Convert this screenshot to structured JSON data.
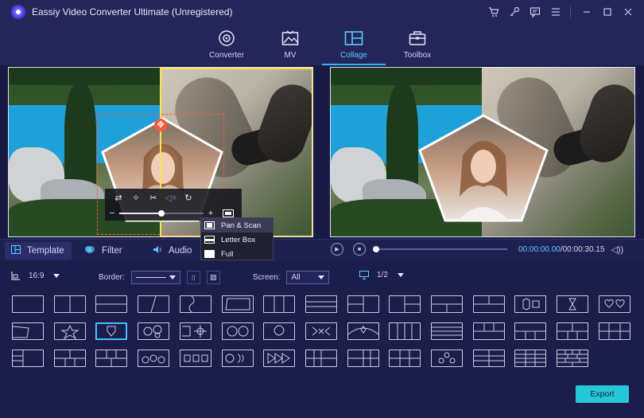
{
  "window": {
    "title": "Eassiy Video Converter Ultimate (Unregistered)",
    "controls": [
      "cart-icon",
      "key-icon",
      "chat-icon",
      "menu-icon",
      "minimize-icon",
      "maximize-icon",
      "close-icon"
    ]
  },
  "nav": {
    "items": [
      {
        "label": "Converter",
        "icon": "converter-icon"
      },
      {
        "label": "MV",
        "icon": "mv-icon"
      },
      {
        "label": "Collage",
        "icon": "collage-icon",
        "active": true
      },
      {
        "label": "Toolbox",
        "icon": "toolbox-icon"
      }
    ]
  },
  "dropdown": {
    "items": [
      "Pan & Scan",
      "Letter Box",
      "Full"
    ],
    "active": "Pan & Scan"
  },
  "edit_toolbar": {
    "zoom_minus": "−",
    "zoom_plus": "+",
    "zoom_level": 0.5
  },
  "tabs": [
    {
      "label": "Template",
      "icon": "template-icon",
      "active": true
    },
    {
      "label": "Filter",
      "icon": "filter-icon"
    },
    {
      "label": "Audio",
      "icon": "audio-icon"
    }
  ],
  "playback": {
    "current": "00:00:00.00",
    "total": "/00:00:30.15",
    "progress": 0.0
  },
  "options": {
    "aspect": "16:9",
    "border_label": "Border:",
    "screen_label": "Screen:",
    "screen_value": "All",
    "page": "1/2"
  },
  "export_label": "Export",
  "colors": {
    "accent": "#2fb5ff",
    "export": "#27c7d8",
    "selection": "#ff5a3c",
    "frame": "#f6e44a"
  }
}
